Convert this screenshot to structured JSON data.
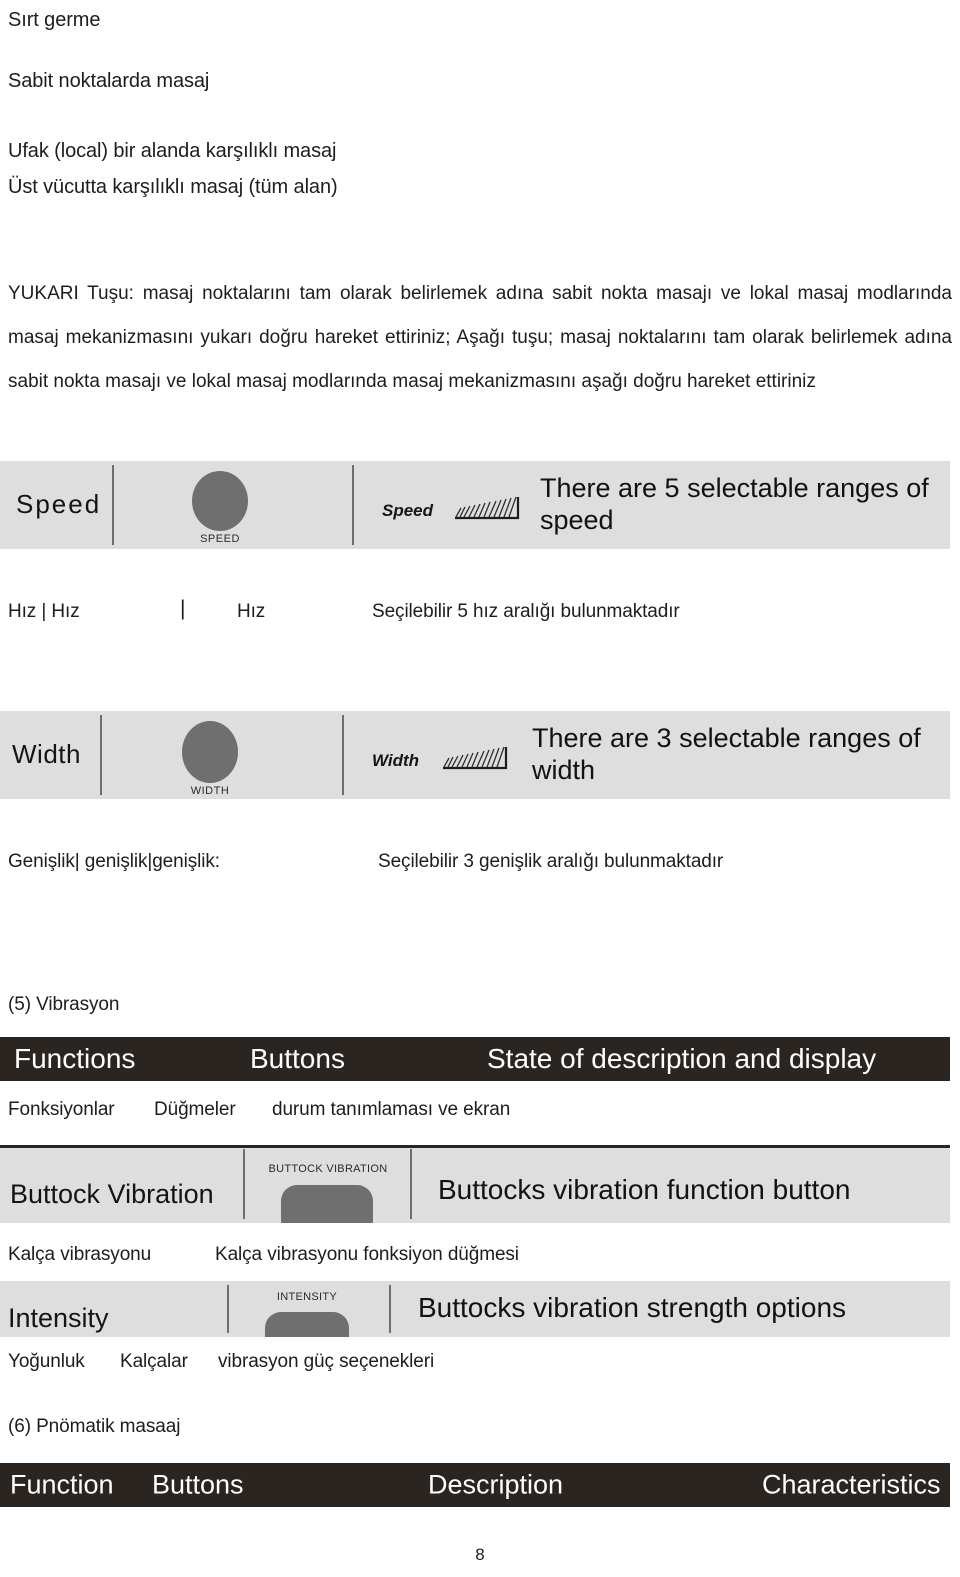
{
  "document": {
    "page_number": "8",
    "headings": [
      {
        "text": "Sırt germe"
      },
      {
        "text": "Sabit noktalarda masaj"
      },
      {
        "text": "Ufak (local) bir alanda karşılıklı masaj"
      },
      {
        "text": "Üst vücutta karşılıklı masaj (tüm alan)"
      }
    ],
    "paragraph": "YUKARI Tuşu: masaj noktalarını tam olarak belirlemek adına sabit nokta masajı ve lokal masaj modlarında masaj mekanizmasını yukarı doğru hareket ettiriniz; Aşağı tuşu;   masaj noktalarını tam olarak belirlemek adına sabit nokta masajı ve lokal masaj modlarında masaj mekanizmasını aşağı doğru hareket ettiriniz"
  },
  "speed_row": {
    "function_label": "Speed",
    "button_caption": "SPEED",
    "state_label": "Speed",
    "description": "There are 5 selectable ranges of\nspeed",
    "translation": {
      "function": "Hız | Hız",
      "divider": "|",
      "button": "Hız",
      "description": "Seçilebilir 5 hız aralığı bulunmaktadır"
    }
  },
  "width_row": {
    "function_label": "Width",
    "button_caption": "WIDTH",
    "state_label": "Width",
    "description": "There are 3 selectable ranges of\nwidth",
    "translation": {
      "function": "Genişlik| genişlik|genişlik:",
      "description": "Seçilebilir 3 genişlik aralığı bulunmaktadır"
    }
  },
  "vibration_section": {
    "section_title": "(5) Vibrasyon",
    "header": {
      "col1": "Functions",
      "col2": "Buttons",
      "col3": "State of description and display"
    },
    "header_translation": {
      "col1": "Fonksiyonlar",
      "col2": "Düğmeler",
      "col3": "durum tanımlaması ve ekran"
    },
    "rows": [
      {
        "function_label": "Buttock Vibration",
        "button_caption": "BUTTOCK VIBRATION",
        "description": "Buttocks vibration function button",
        "translation": {
          "function": "Kalça vibrasyonu",
          "description": "Kalça vibrasyonu fonksiyon düğmesi"
        }
      },
      {
        "function_label": "Intensity",
        "button_caption": "INTENSITY",
        "description": "Buttocks vibration strength options",
        "translation": {
          "function": "Yoğunluk",
          "button": "Kalçalar",
          "description": "vibrasyon güç seçenekleri"
        }
      }
    ]
  },
  "pneumatic_section": {
    "section_title": "(6) Pnömatik masaaj",
    "header": {
      "col1": "Function",
      "col2": "Buttons",
      "col3": "Description",
      "col4": "Characteristics"
    }
  },
  "colors": {
    "page_background": "#ffffff",
    "text": "#1d1d1d",
    "strip_background": "#dedede",
    "dark_header": "#2a2520",
    "dark_header_text": "#ffffff",
    "knob_fill": "#6f6f6f",
    "divider": "#6e6e6e"
  }
}
